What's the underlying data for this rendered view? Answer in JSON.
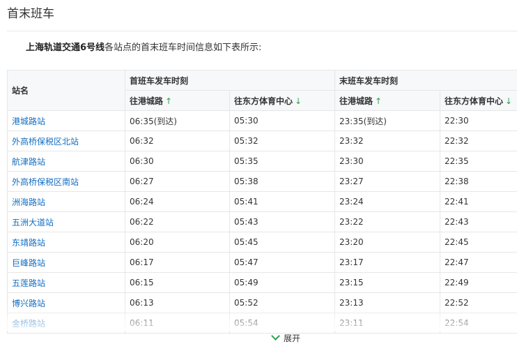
{
  "section_title": "首末班车",
  "intro": {
    "bold_text": "上海轨道交通6号线",
    "rest_text": "各站点的首末班车时间信息如下表所示:"
  },
  "table": {
    "station_header": "站名",
    "first_train_header": "首班车发车时刻",
    "last_train_header": "末班车发车时刻",
    "direction_1": "往港城路",
    "direction_2": "往东方体育中心",
    "arrow_up": "↑",
    "arrow_down": "↓",
    "rows": [
      {
        "station": "港城路站",
        "first_1": "06:35(到达)",
        "first_2": "05:30",
        "last_1": "23:35(到达)",
        "last_2": "22:30"
      },
      {
        "station": "外高桥保税区北站",
        "first_1": "06:32",
        "first_2": "05:32",
        "last_1": "23:32",
        "last_2": "22:32"
      },
      {
        "station": "航津路站",
        "first_1": "06:30",
        "first_2": "05:35",
        "last_1": "23:30",
        "last_2": "22:35"
      },
      {
        "station": "外高桥保税区南站",
        "first_1": "06:27",
        "first_2": "05:38",
        "last_1": "23:27",
        "last_2": "22:38"
      },
      {
        "station": "洲海路站",
        "first_1": "06:24",
        "first_2": "05:41",
        "last_1": "23:24",
        "last_2": "22:41"
      },
      {
        "station": "五洲大道站",
        "first_1": "06:22",
        "first_2": "05:43",
        "last_1": "23:22",
        "last_2": "22:43"
      },
      {
        "station": "东靖路站",
        "first_1": "06:20",
        "first_2": "05:45",
        "last_1": "23:20",
        "last_2": "22:45"
      },
      {
        "station": "巨峰路站",
        "first_1": "06:17",
        "first_2": "05:47",
        "last_1": "23:17",
        "last_2": "22:47"
      },
      {
        "station": "五莲路站",
        "first_1": "06:15",
        "first_2": "05:49",
        "last_1": "23:15",
        "last_2": "22:49"
      },
      {
        "station": "博兴路站",
        "first_1": "06:13",
        "first_2": "05:52",
        "last_1": "23:13",
        "last_2": "22:52"
      },
      {
        "station": "金桥路站",
        "first_1": "06:11",
        "first_2": "05:54",
        "last_1": "23:11",
        "last_2": "22:54"
      }
    ]
  },
  "expand_label": "展开",
  "icons": {
    "expand": "chevron-down-icon"
  },
  "colors": {
    "link": "#136ec2",
    "arrow": "#2ba24c",
    "header_bg": "#f7f8fa",
    "border": "#e6e6e6"
  }
}
